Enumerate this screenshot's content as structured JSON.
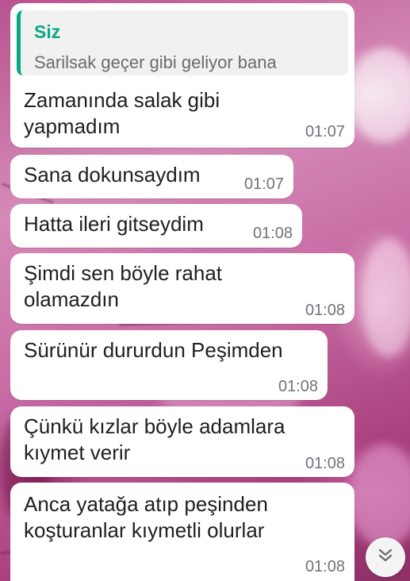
{
  "chat": {
    "reply_quote": {
      "author": "Siz",
      "text": "Sarilsak geçer gibi geliyor bana"
    },
    "messages": [
      {
        "text": "Zamanında salak gibi\nyapmadım",
        "time": "01:07"
      },
      {
        "text": "Sana dokunsaydım",
        "time": "01:07"
      },
      {
        "text": "Hatta ileri gitseydim",
        "time": "01:08"
      },
      {
        "text": "Şimdi sen böyle rahat\nolamazdın",
        "time": "01:08"
      },
      {
        "text": "Sürünür dururdun Peşimden",
        "time": "01:08"
      },
      {
        "text": "Çünkü kızlar böyle adamlara\nkıymet verir",
        "time": "01:08"
      },
      {
        "text": "Anca yatağa atıp peşinden\nkoşturanlar kıymetli olurlar",
        "time": "01:08"
      }
    ]
  },
  "icons": {
    "scroll_down": "double-chevron-down-icon"
  },
  "colors": {
    "bubble": "#ffffff",
    "quote_accent": "#06a884",
    "time_text": "#6f7379"
  }
}
